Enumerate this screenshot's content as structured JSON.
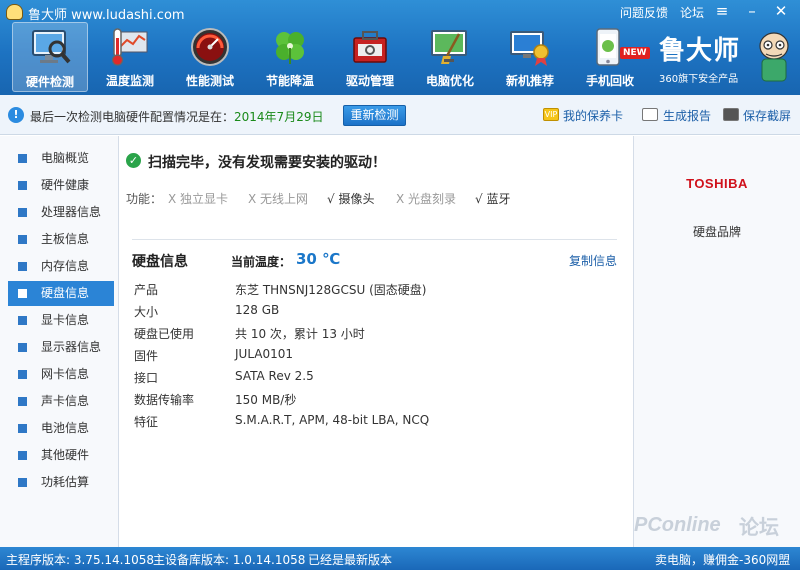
{
  "app": {
    "title": "鲁大师 www.ludashi.com",
    "links": {
      "feedback": "问题反馈",
      "forum": "论坛"
    },
    "brand_name": "鲁大师",
    "brand_sub": "360旗下安全产品"
  },
  "nav": [
    {
      "label": "硬件检测",
      "icon": "monitor-magnifier-icon",
      "active": true
    },
    {
      "label": "温度监测",
      "icon": "thermometer-icon"
    },
    {
      "label": "性能测试",
      "icon": "speedometer-icon"
    },
    {
      "label": "节能降温",
      "icon": "clover-leaf-icon"
    },
    {
      "label": "驱动管理",
      "icon": "toolbox-icon"
    },
    {
      "label": "电脑优化",
      "icon": "broom-screen-icon"
    },
    {
      "label": "新机推荐",
      "icon": "medal-screen-icon"
    },
    {
      "label": "手机回收",
      "icon": "phone-icon",
      "badge": "NEW"
    }
  ],
  "infobar": {
    "text": "最后一次检测电脑硬件配置情况是在：",
    "date": "2014年7月29日",
    "recheck": "重新检测",
    "warranty": "我的保养卡",
    "report": "生成报告",
    "screenshot": "保存截屏"
  },
  "sidebar": {
    "items": [
      "电脑概览",
      "硬件健康",
      "处理器信息",
      "主板信息",
      "内存信息",
      "硬盘信息",
      "显卡信息",
      "显示器信息",
      "网卡信息",
      "声卡信息",
      "电池信息",
      "其他硬件",
      "功耗估算"
    ],
    "active_index": 5
  },
  "main": {
    "scan_title": "扫描完毕，没有发现需要安装的驱动！",
    "func_label": "功能：",
    "functions": [
      {
        "label": "X  独立显卡",
        "state": "off"
      },
      {
        "label": "X  无线上网",
        "state": "off"
      },
      {
        "label": "√  摄像头",
        "state": "on"
      },
      {
        "label": "X  光盘刻录",
        "state": "off"
      },
      {
        "label": "√  蓝牙",
        "state": "on"
      }
    ],
    "section_title": "硬盘信息",
    "temp_label": "当前温度：",
    "temp_value": "30 ℃",
    "copy": "复制信息",
    "rows": [
      {
        "label": "产品",
        "value": "东芝  THNSNJ128GCSU (固态硬盘)"
      },
      {
        "label": "大小",
        "value": "128 GB"
      },
      {
        "label": "硬盘已使用",
        "value": "共 10 次，累计 13 小时"
      },
      {
        "label": "固件",
        "value": "JULA0101"
      },
      {
        "label": "接口",
        "value": "SATA Rev 2.5"
      },
      {
        "label": "数据传输率",
        "value": "150 MB/秒"
      },
      {
        "label": "特征",
        "value": "S.M.A.R.T,  APM,  48-bit LBA,  NCQ"
      }
    ]
  },
  "rightpanel": {
    "brand_logo": "TOSHIBA",
    "caption": "硬盘品牌",
    "watermark": "PConline",
    "watermark2": "论坛"
  },
  "statusbar": {
    "main_version": "主程序版本: 3.75.14.1058",
    "db_version": "主设备库版本: 1.0.14.1058",
    "latest": "已经是最新版本",
    "promo": "卖电脑，赚佣金-360网盟"
  }
}
